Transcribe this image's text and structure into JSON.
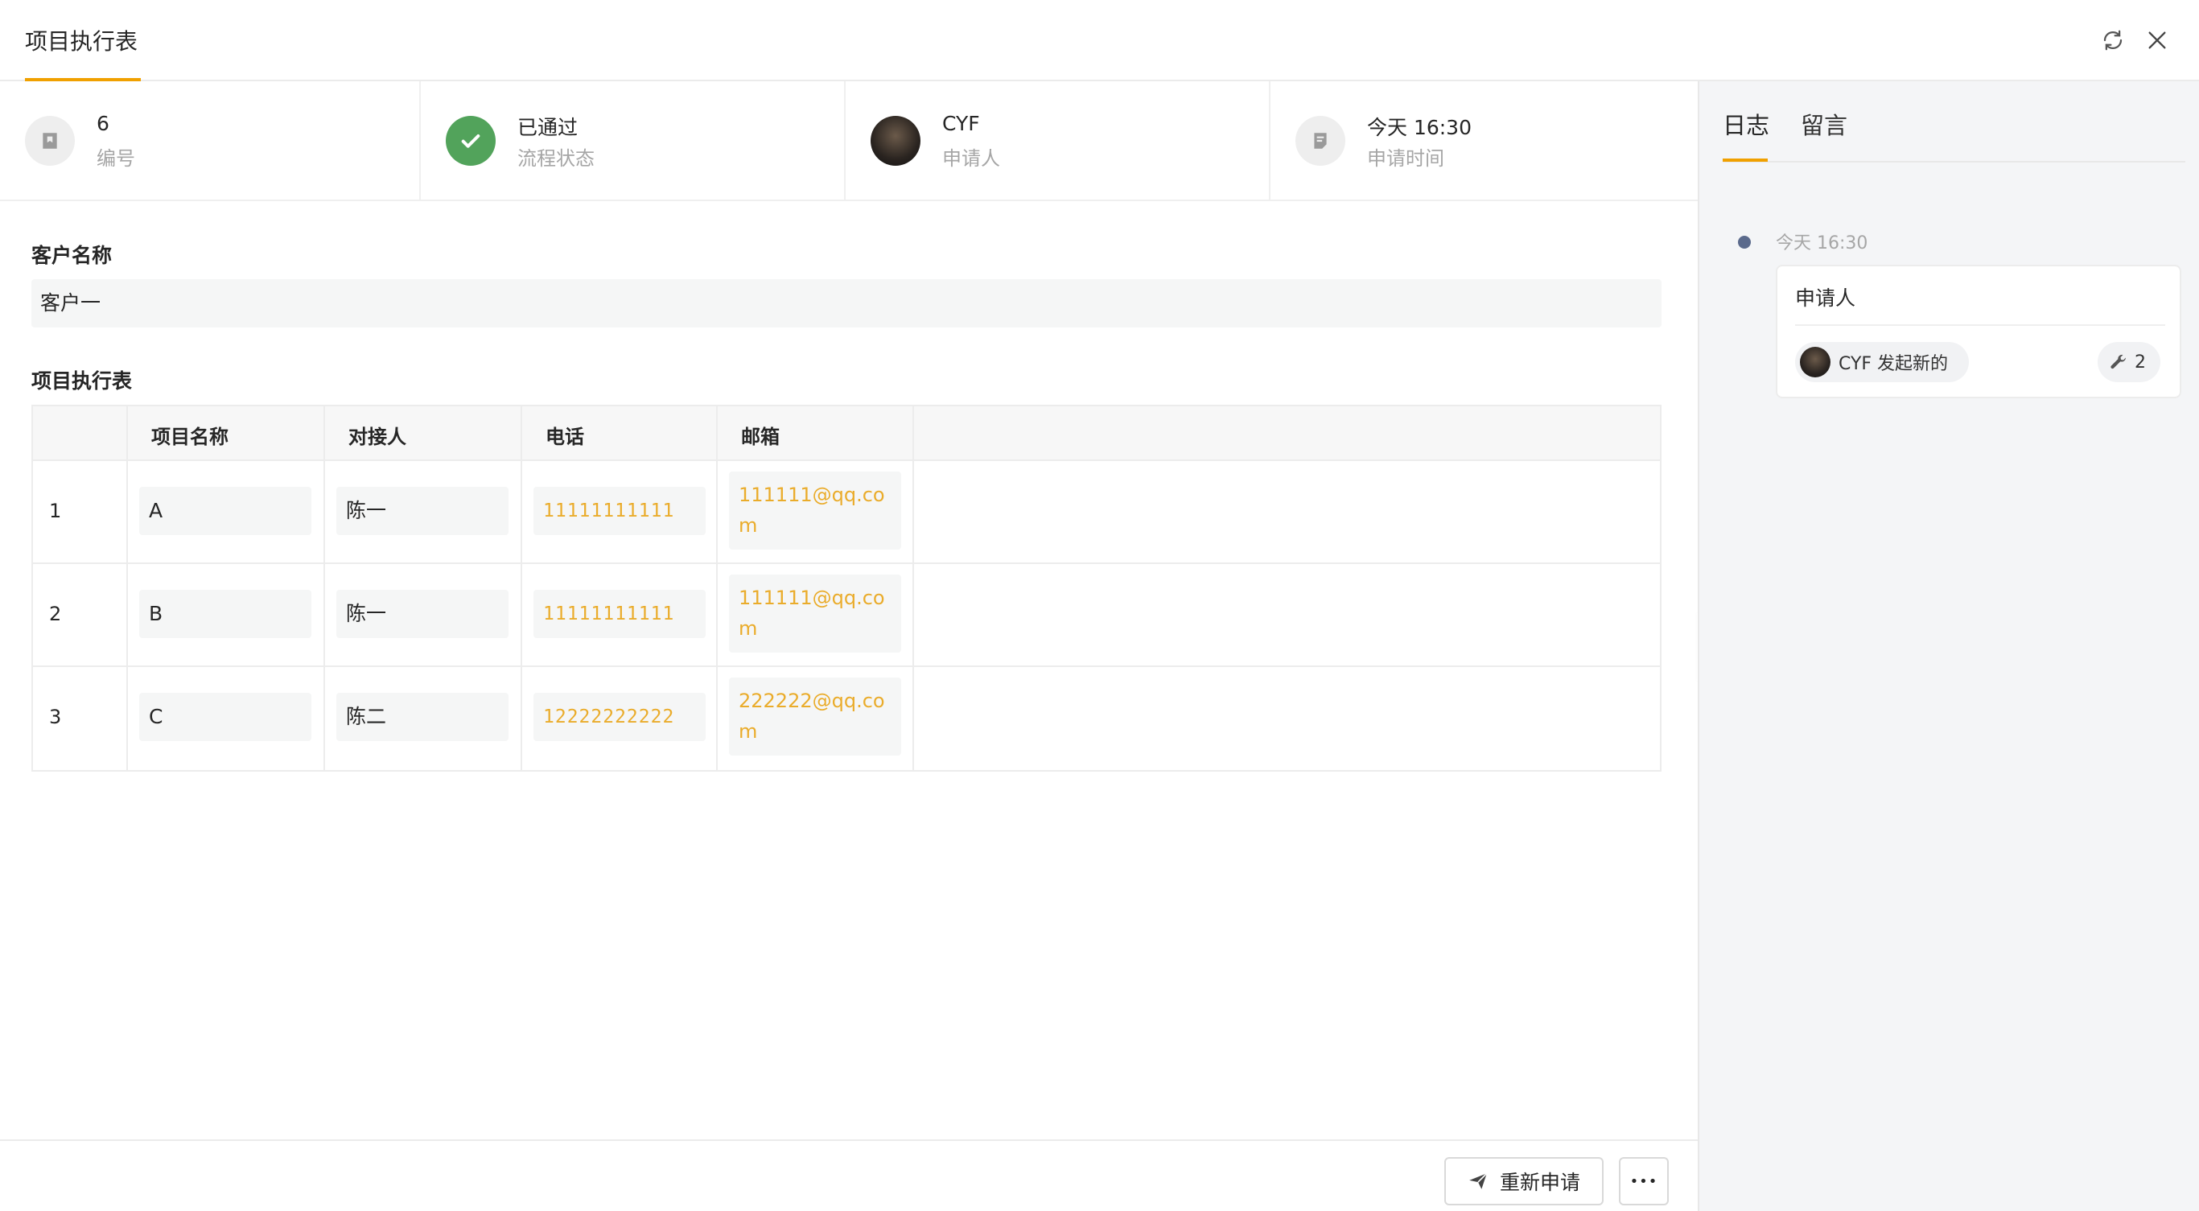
{
  "header": {
    "title": "项目执行表"
  },
  "info_bar": [
    {
      "value": "6",
      "label": "编号",
      "icon": "bookmark-icon"
    },
    {
      "value": "已通过",
      "label": "流程状态",
      "icon": "check-circle-icon"
    },
    {
      "value": "CYF",
      "label": "申请人",
      "icon": "avatar"
    },
    {
      "value": "今天 16:30",
      "label": "申请时间",
      "icon": "document-icon"
    }
  ],
  "form": {
    "customer_label": "客户名称",
    "customer_value": "客户一",
    "table_label": "项目执行表",
    "columns": [
      "",
      "项目名称",
      "对接人",
      "电话",
      "邮箱"
    ],
    "rows": [
      {
        "no": "1",
        "name": "A",
        "contact": "陈一",
        "phone": "11111111111",
        "email": "111111@qq.com"
      },
      {
        "no": "2",
        "name": "B",
        "contact": "陈一",
        "phone": "11111111111",
        "email": "111111@qq.com"
      },
      {
        "no": "3",
        "name": "C",
        "contact": "陈二",
        "phone": "12222222222",
        "email": "222222@qq.com"
      }
    ]
  },
  "footer": {
    "reapply_label": "重新申请",
    "more_label": "•••"
  },
  "side": {
    "tabs": [
      "日志",
      "留言"
    ],
    "log": {
      "time": "今天 16:30",
      "title": "申请人",
      "actor": "CYF 发起新的",
      "count": "2"
    }
  },
  "colors": {
    "accent": "#f0a000",
    "success": "#52a35b",
    "link": "#eaac2b"
  }
}
